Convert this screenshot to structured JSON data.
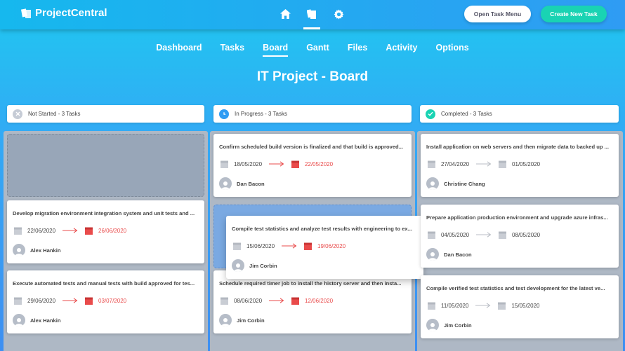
{
  "app": {
    "title": "ProjectCentral"
  },
  "topnav": {
    "icons": [
      "home-icon",
      "tasks-icon",
      "settings-icon"
    ],
    "active": "tasks-icon"
  },
  "buttons": {
    "open_task_menu": "Open Task Menu",
    "create_new_task": "Create New Task"
  },
  "subnav": {
    "items": [
      {
        "label": "Dashboard"
      },
      {
        "label": "Tasks"
      },
      {
        "label": "Board"
      },
      {
        "label": "Gantt"
      },
      {
        "label": "Files"
      },
      {
        "label": "Activity"
      },
      {
        "label": "Options"
      }
    ],
    "active": "Board"
  },
  "page": {
    "title": "IT Project - Board"
  },
  "colors": {
    "accent": "#19d3b3",
    "late_date": "#e94b4b",
    "in_progress": "#2f9cf3"
  },
  "columns": [
    {
      "header": "Not Started - 3 Tasks",
      "status_icon": "close-circle-icon",
      "cards": [
        {
          "title": "Develop migration environment integration system and unit tests and ...",
          "start": "22/06/2020",
          "end": "26/06/2020",
          "assignee": "Alex Hankin"
        },
        {
          "title": "Execute automated tests and manual tests with build approved for tes...",
          "start": "29/06/2020",
          "end": "03/07/2020",
          "assignee": "Alex Hankin"
        }
      ]
    },
    {
      "header": "In Progress - 3 Tasks",
      "status_icon": "clock-icon",
      "cards": [
        {
          "title": "Confirm scheduled build version is finalized and that build is approved...",
          "start": "18/05/2020",
          "end": "22/05/2020",
          "assignee": "Dan Bacon"
        },
        {
          "title": "Schedule required timer job to install the history server and then insta...",
          "start": "08/06/2020",
          "end": "12/06/2020",
          "assignee": "Jim Corbin"
        }
      ],
      "dragging_card": {
        "title": "Compile test statistics and analyze test results with engineering to ex...",
        "start": "15/06/2020",
        "end": "19/06/2020",
        "assignee": "Jim Corbin"
      }
    },
    {
      "header": "Completed - 3 Tasks",
      "status_icon": "check-circle-icon",
      "cards": [
        {
          "title": "Install application on web servers and then migrate data to backed up ...",
          "start": "27/04/2020",
          "end": "01/05/2020",
          "assignee": "Christine Chang"
        },
        {
          "title": "Prepare application production environment and upgrade azure infras...",
          "start": "04/05/2020",
          "end": "08/05/2020",
          "assignee": "Dan Bacon"
        },
        {
          "title": "Compile verified test statistics and test development for the latest ve...",
          "start": "11/05/2020",
          "end": "15/05/2020",
          "assignee": "Jim Corbin"
        }
      ]
    }
  ]
}
